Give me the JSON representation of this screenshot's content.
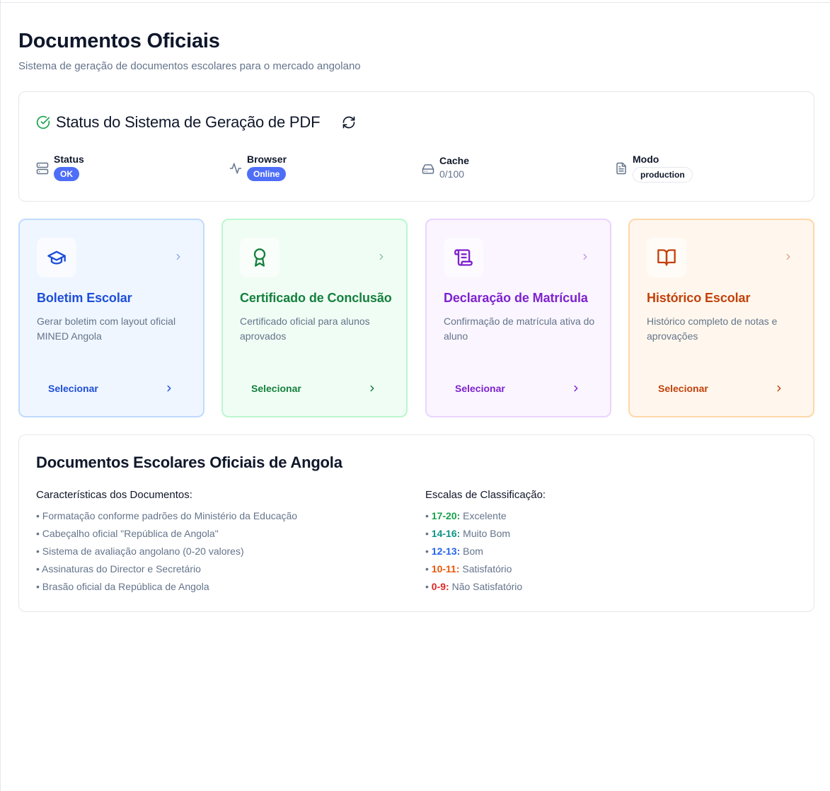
{
  "header": {
    "title": "Documentos Oficiais",
    "subtitle": "Sistema de geração de documentos escolares para o mercado angolano"
  },
  "status_panel": {
    "title": "Status do Sistema de Geração de PDF",
    "icons": {
      "title": "check-circle-icon",
      "refresh": "refresh-icon"
    },
    "items": [
      {
        "label": "Status",
        "value": "OK",
        "icon": "server-icon",
        "style": "badge-solid"
      },
      {
        "label": "Browser",
        "value": "Online",
        "icon": "activity-icon",
        "style": "badge-solid"
      },
      {
        "label": "Cache",
        "value": "0/100",
        "icon": "hard-drive-icon",
        "style": "text"
      },
      {
        "label": "Modo",
        "value": "production",
        "icon": "file-text-icon",
        "style": "badge-outline"
      }
    ]
  },
  "documents": [
    {
      "title": "Boletim Escolar",
      "description": "Gerar boletim com layout oficial MINED Angola",
      "action": "Selecionar",
      "icon": "graduation-cap-icon",
      "color": "#1d4ed8"
    },
    {
      "title": "Certificado de Conclusão",
      "description": "Certificado oficial para alunos aprovados",
      "action": "Selecionar",
      "icon": "award-icon",
      "color": "#15803d"
    },
    {
      "title": "Declaração de Matrícula",
      "description": "Confirmação de matrícula ativa do aluno",
      "action": "Selecionar",
      "icon": "scroll-icon",
      "color": "#7e22ce"
    },
    {
      "title": "Histórico Escolar",
      "description": "Histórico completo de notas e aprovações",
      "action": "Selecionar",
      "icon": "book-open-icon",
      "color": "#c2410c"
    }
  ],
  "info": {
    "title": "Documentos Escolares Oficiais de Angola",
    "features": {
      "heading": "Características dos Documentos:",
      "items": [
        "• Formatação conforme padrões do Ministério da Educação",
        "• Cabeçalho oficial \"República de Angola\"",
        "• Sistema de avaliação angolano (0-20 valores)",
        "• Assinaturas do Director e Secretário",
        "• Brasão oficial da República de Angola"
      ]
    },
    "scales": {
      "heading": "Escalas de Classificação:",
      "items": [
        {
          "range": "17-20:",
          "label": "Excelente",
          "color": "#16a34a"
        },
        {
          "range": "14-16:",
          "label": "Muito Bom",
          "color": "#0d9488"
        },
        {
          "range": "12-13:",
          "label": "Bom",
          "color": "#2563eb"
        },
        {
          "range": "10-11:",
          "label": "Satisfatório",
          "color": "#ea580c"
        },
        {
          "range": "0-9:",
          "label": "Não Satisfatório",
          "color": "#dc2626"
        }
      ]
    }
  }
}
